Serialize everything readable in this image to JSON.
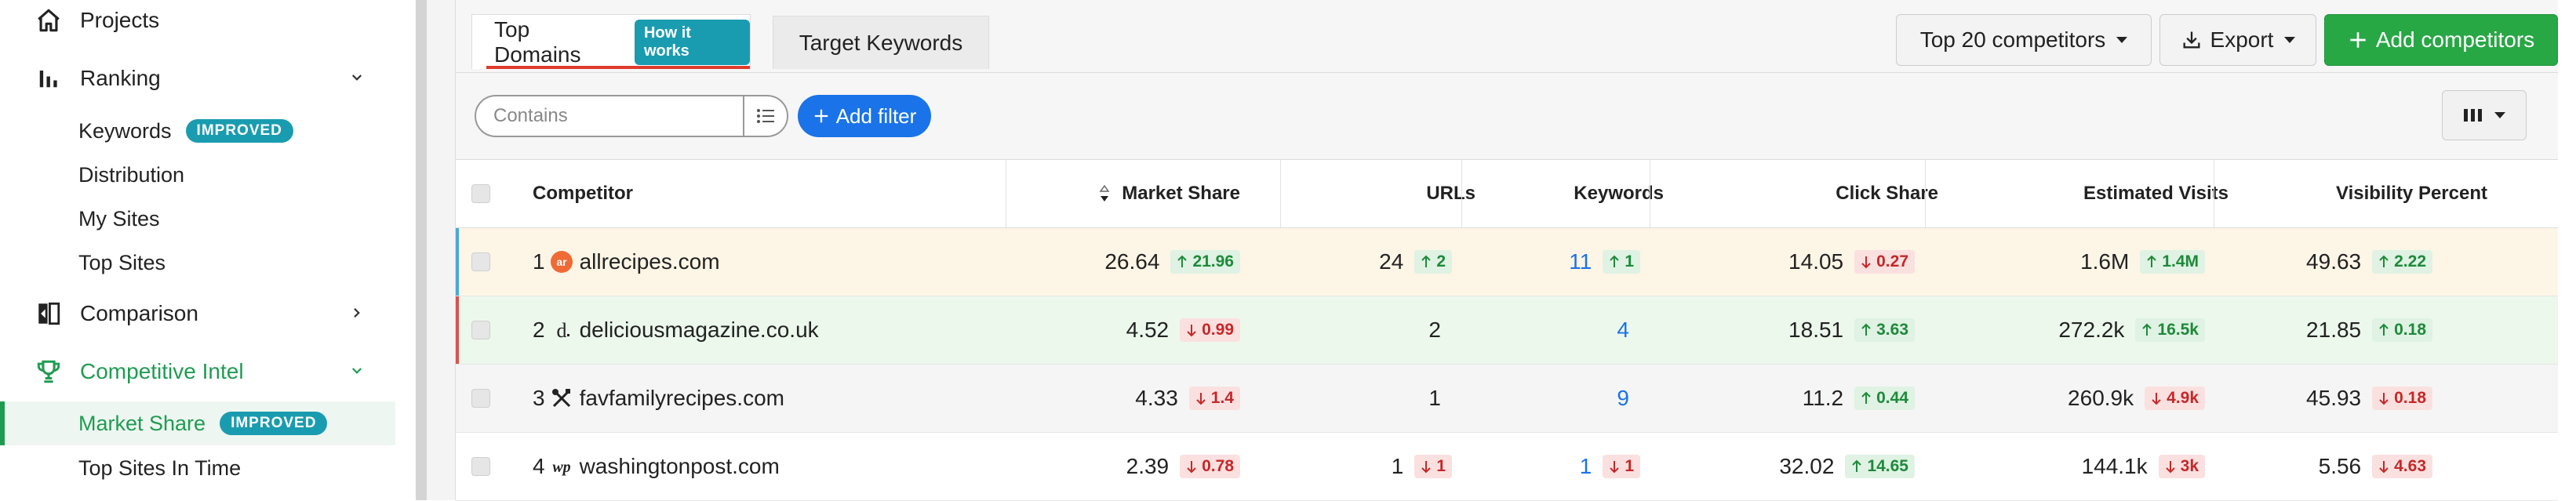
{
  "sidebar": {
    "projects": "Projects",
    "ranking": "Ranking",
    "keywords": "Keywords",
    "keywords_badge": "IMPROVED",
    "distribution": "Distribution",
    "my_sites": "My Sites",
    "top_sites": "Top Sites",
    "comparison": "Comparison",
    "competitive_intel": "Competitive Intel",
    "market_share": "Market Share",
    "market_share_badge": "IMPROVED",
    "top_sites_in_time": "Top Sites In Time"
  },
  "tabs": {
    "top_domains": "Top Domains",
    "how_it_works": "How it works",
    "target_keywords": "Target Keywords"
  },
  "toolbar": {
    "top_competitors": "Top 20 competitors",
    "export": "Export",
    "add_competitors": "Add competitors"
  },
  "filter": {
    "placeholder": "Contains",
    "add_filter": "Add filter"
  },
  "columns": [
    "Competitor",
    "Market Share",
    "URLs",
    "Keywords",
    "Click Share",
    "Estimated Visits",
    "Visibility Percent"
  ],
  "rows": [
    {
      "rank": "1",
      "domain": "allrecipes.com",
      "favicon": "allrecipes-icon",
      "market_share": "26.64",
      "ms_chg": "21.96",
      "ms_dir": "up",
      "urls": "24",
      "urls_chg": "2",
      "urls_dir": "up",
      "keywords": "11",
      "kw_chg": "1",
      "kw_dir": "up",
      "click_share": "14.05",
      "cs_chg": "0.27",
      "cs_dir": "down",
      "visits": "1.6M",
      "v_chg": "1.4M",
      "v_dir": "up",
      "visibility": "49.63",
      "vis_chg": "2.22",
      "vis_dir": "up"
    },
    {
      "rank": "2",
      "domain": "deliciousmagazine.co.uk",
      "favicon": "delicious-icon",
      "market_share": "4.52",
      "ms_chg": "0.99",
      "ms_dir": "down",
      "urls": "2",
      "urls_chg": "",
      "urls_dir": "",
      "keywords": "4",
      "kw_chg": "",
      "kw_dir": "",
      "click_share": "18.51",
      "cs_chg": "3.63",
      "cs_dir": "up",
      "visits": "272.2k",
      "v_chg": "16.5k",
      "v_dir": "up",
      "visibility": "21.85",
      "vis_chg": "0.18",
      "vis_dir": "up"
    },
    {
      "rank": "3",
      "domain": "favfamilyrecipes.com",
      "favicon": "utensils-icon",
      "market_share": "4.33",
      "ms_chg": "1.4",
      "ms_dir": "down",
      "urls": "1",
      "urls_chg": "",
      "urls_dir": "",
      "keywords": "9",
      "kw_chg": "",
      "kw_dir": "",
      "click_share": "11.2",
      "cs_chg": "0.44",
      "cs_dir": "up",
      "visits": "260.9k",
      "v_chg": "4.9k",
      "v_dir": "down",
      "visibility": "45.93",
      "vis_chg": "0.18",
      "vis_dir": "down"
    },
    {
      "rank": "4",
      "domain": "washingtonpost.com",
      "favicon": "wp-icon",
      "market_share": "2.39",
      "ms_chg": "0.78",
      "ms_dir": "down",
      "urls": "1",
      "urls_chg": "1",
      "urls_dir": "down",
      "keywords": "1",
      "kw_chg": "1",
      "kw_dir": "down",
      "click_share": "32.02",
      "cs_chg": "14.65",
      "cs_dir": "up",
      "visits": "144.1k",
      "v_chg": "3k",
      "v_dir": "down",
      "visibility": "5.56",
      "vis_chg": "4.63",
      "vis_dir": "down"
    }
  ],
  "colors": {
    "accent_green": "#28a745",
    "accent_blue": "#1a73e8",
    "teal_badge": "#1a9cb0",
    "up": "#1e8a3a",
    "down": "#c62828",
    "tab_underline": "#e03b2c",
    "row1_bg": "#fdf5e6",
    "row2_bg": "#ecf8ec",
    "row3_bg": "#f5f5f5",
    "row1_marker": "#4aa9d6",
    "row2_marker": "#d9534f"
  }
}
